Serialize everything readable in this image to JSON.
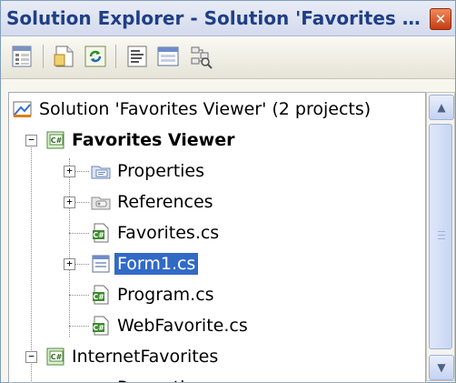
{
  "window": {
    "title": "Solution Explorer - Solution 'Favorites V...",
    "close_glyph": "✕"
  },
  "toolbar": {
    "buttons": [
      {
        "name": "properties-icon"
      },
      {
        "name": "show-all-files-icon"
      },
      {
        "name": "refresh-icon"
      },
      {
        "name": "view-code-icon"
      },
      {
        "name": "view-designer-icon"
      },
      {
        "name": "class-view-icon"
      }
    ]
  },
  "tree": {
    "items": [
      {
        "label": "Solution 'Favorites Viewer' (2 projects)",
        "icon": "solution-icon"
      },
      {
        "label": "Favorites Viewer",
        "icon": "csharp-project-icon",
        "bold": true,
        "expander": "−"
      },
      {
        "label": "Properties",
        "icon": "properties-folder-icon",
        "expander": "+"
      },
      {
        "label": "References",
        "icon": "references-folder-icon",
        "expander": "+"
      },
      {
        "label": "Favorites.cs",
        "icon": "csharp-file-icon"
      },
      {
        "label": "Form1.cs",
        "icon": "form-icon",
        "expander": "+",
        "selected": true
      },
      {
        "label": "Program.cs",
        "icon": "csharp-file-icon"
      },
      {
        "label": "WebFavorite.cs",
        "icon": "csharp-file-icon"
      },
      {
        "label": "InternetFavorites",
        "icon": "csharp-project-icon",
        "expander": "−"
      },
      {
        "label": "Properties",
        "icon": "properties-folder-icon",
        "expander": "+"
      }
    ]
  },
  "scrollbar": {
    "up": "▲",
    "down": "▼"
  },
  "colors": {
    "selection": "#316ac5",
    "title": "#1f3f86"
  }
}
